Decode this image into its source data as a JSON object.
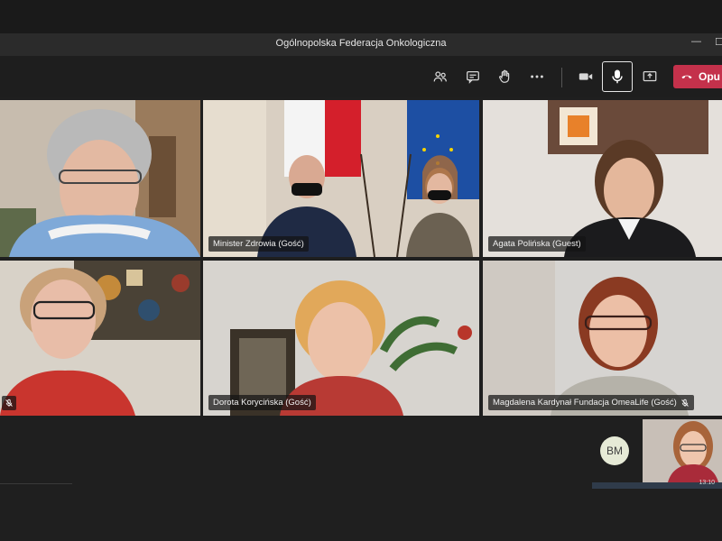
{
  "window": {
    "title": "Ogólnopolska Federacja Onkologiczna",
    "minimize_glyph": "—",
    "maximize_glyph": "☐"
  },
  "toolbar": {
    "icons": [
      "participants-icon",
      "chat-icon",
      "raise-hand-icon",
      "more-icon",
      "camera-icon",
      "microphone-icon",
      "share-screen-icon"
    ],
    "leave_label": "Opu"
  },
  "participants": [
    {
      "name": ""
    },
    {
      "name": "Minister Zdrowia (Gość)"
    },
    {
      "name": "Agata Polińska (Guest)"
    },
    {
      "name": ""
    },
    {
      "name": "Dorota Korycińska (Gość)"
    },
    {
      "name": "Magdalena Kardynał Fundacja OmeaLife (Gość)"
    }
  ],
  "tray": {
    "avatar_initials": "BM",
    "self_view_time": "13:10"
  },
  "colors": {
    "accent_leave": "#c4314b",
    "background": "#1f1f1f"
  }
}
